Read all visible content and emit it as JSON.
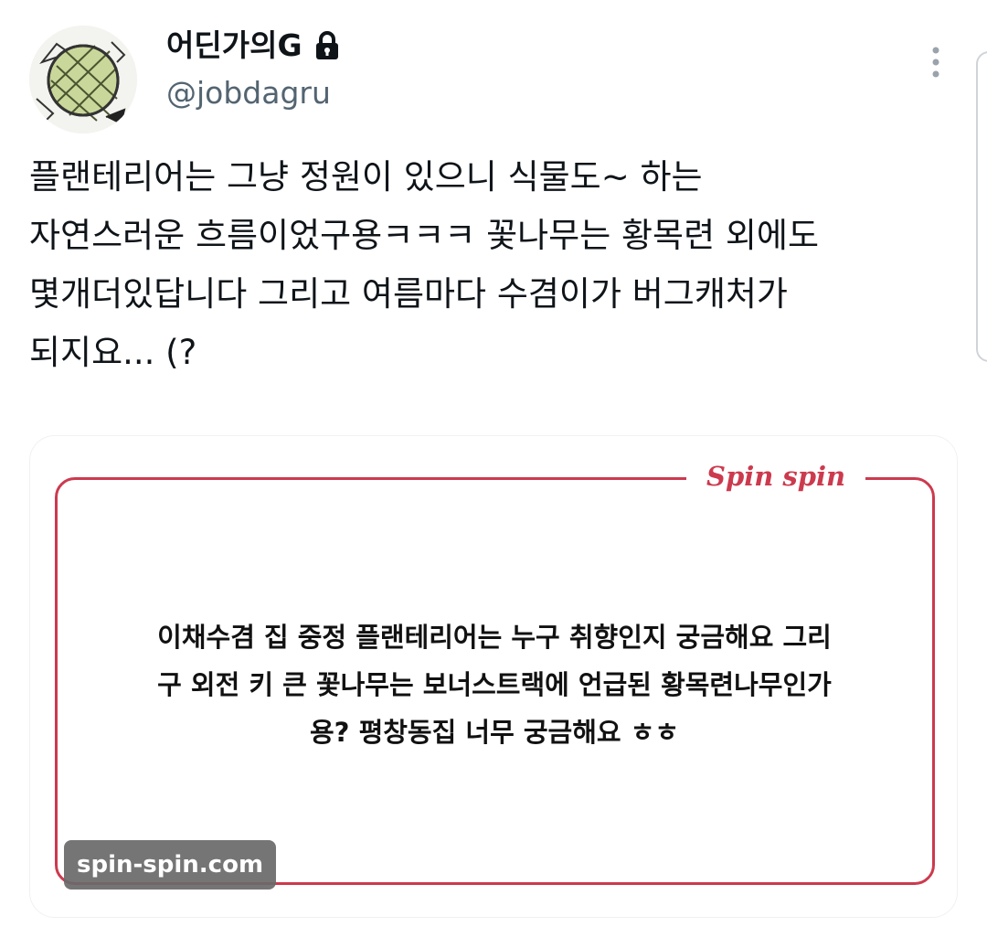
{
  "author": {
    "display_name": "어딘가의G",
    "handle": "@jobdagru",
    "avatar_icon": "avatar-image",
    "locked": true,
    "lock_icon": "lock-icon"
  },
  "menu": {
    "icon": "more-vertical-icon"
  },
  "tweet": {
    "text": "플랜테리어는 그냥 정원이 있으니 식물도~ 하는\n자연스러운 흐름이었구용ㅋㅋㅋ 꽃나무는 황목련 외에도\n몇개더있답니다 그리고 여름마다 수겸이가 버그캐처가\n되지요... (?"
  },
  "media": {
    "brand": "Spin spin",
    "question": "이채수겸 집 중정 플랜테리어는 누구 취향인지 궁금해요 그리\n구 외전 키 큰 꽃나무는 보너스트랙에 언급된 황목련나무인가\n용? 평창동집 너무 궁금해요 ㅎㅎ",
    "watermark": "spin-spin.com",
    "accent_color": "#cc3a4e"
  }
}
